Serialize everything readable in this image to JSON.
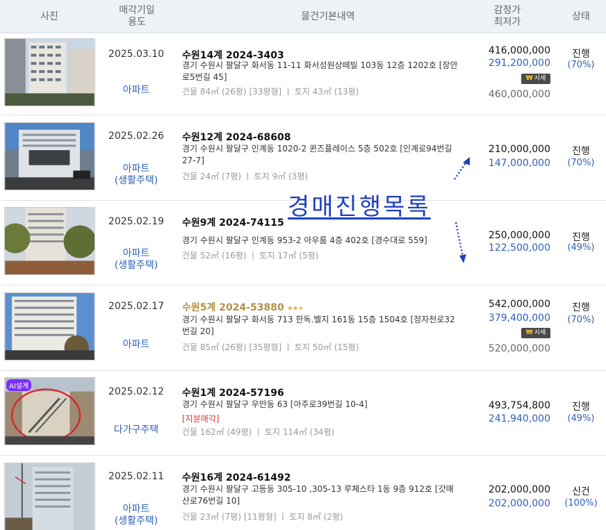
{
  "header": {
    "photo": "사진",
    "date_line1": "매각기일",
    "date_line2": "용도",
    "info": "물건기본내역",
    "price_line1": "감정가",
    "price_line2": "최저가",
    "status": "상태"
  },
  "overlay_text": "경매진행목록",
  "sise_label": "시세",
  "ai_badge": "AI설계",
  "rows": [
    {
      "date": "2025.03.10",
      "type1": "아파트",
      "type2": "",
      "case": "수원14계 2024-3403",
      "addr": "경기 수원시 팔달구 화서동 11-11 화서성원상떼빌 103동 12층 1202호 [장안로5번길 45]",
      "partial": "",
      "area": "건물 84㎡ (26평) [33평형]  ㅣ  토지 43㎡ (13평)",
      "appraisal": "416,000,000",
      "min": "291,200,000",
      "prev": "460,000,000",
      "status": "진행",
      "rate": "(70%)"
    },
    {
      "date": "2025.02.26",
      "type1": "아파트",
      "type2": "(생활주택)",
      "case": "수원12계 2024-68608",
      "addr": "경기 수원시 팔달구 인계동 1020-2 퀸즈플레이스 5층 502호 [인계로94번길 27-7]",
      "partial": "",
      "area": "건물 24㎡ (7평)  ㅣ  토지 9㎡ (3평)",
      "appraisal": "210,000,000",
      "min": "147,000,000",
      "prev": "",
      "status": "진행",
      "rate": "(70%)"
    },
    {
      "date": "2025.02.19",
      "type1": "아파트",
      "type2": "(생활주택)",
      "case": "수원9계 2024-74115",
      "addr": "경기 수원시 팔달구 인계동 953-2 아우룸 4층 402호 [경수대로 559]",
      "partial": "",
      "area": "건물 52㎡ (16평)  ㅣ  토지 17㎡ (5평)",
      "appraisal": "250,000,000",
      "min": "122,500,000",
      "prev": "",
      "status": "진행",
      "rate": "(49%)"
    },
    {
      "date": "2025.02.17",
      "type1": "아파트",
      "type2": "",
      "case": "수원5계 2024-53880",
      "addr": "경기 수원시 팔달구 화서동 713 한독.벨지 161동 15층 1504호 [정자천로32번길 20]",
      "partial": "",
      "area": "건물 85㎡ (26평) [35평형]  ㅣ  토지 50㎡ (15평)",
      "appraisal": "542,000,000",
      "min": "379,400,000",
      "prev": "520,000,000",
      "status": "진행",
      "rate": "(70%)"
    },
    {
      "date": "2025.02.12",
      "type1": "다가구주택",
      "type2": "",
      "case": "수원1계 2024-57196",
      "addr": "경기 수원시 팔달구 우만동 63 [아주로39번길 10-4]",
      "partial": "[지분매각]",
      "area": "건물 162㎡ (49평)  ㅣ  토지 114㎡ (34평)",
      "appraisal": "493,754,800",
      "min": "241,940,000",
      "prev": "",
      "status": "진행",
      "rate": "(49%)"
    },
    {
      "date": "2025.02.11",
      "type1": "아파트",
      "type2": "(생활주택)",
      "case": "수원16계 2024-61492",
      "addr": "경기 수원시 팔달구 고등동 305-10 ,305-13 루체스타 1동 9층 912호 [갓매산로76번길 10]",
      "partial": "",
      "area": "건물 23㎡ (7평) [11평형]  ㅣ  토지 8㎡ (2평)",
      "appraisal": "202,000,000",
      "min": "202,000,000",
      "prev": "",
      "status": "신건",
      "rate": "(100%)"
    }
  ]
}
